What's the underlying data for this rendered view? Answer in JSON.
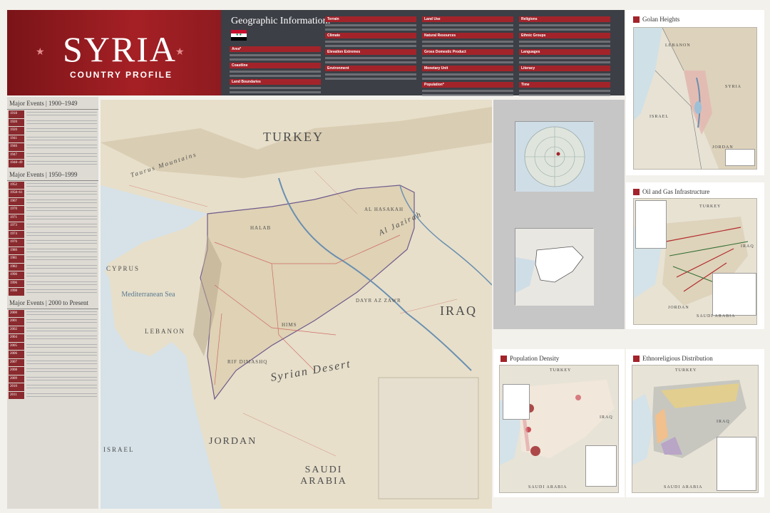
{
  "header": {
    "title": "SYRIA",
    "subtitle": "COUNTRY PROFILE",
    "geo_heading": "Geographic Information:",
    "geo_sections": [
      "Area*",
      "Coastline",
      "Land Boundaries",
      "Terrain",
      "Climate",
      "Elevation Extremes",
      "Environment",
      "Land Use",
      "Natural Resources",
      "Gross Domestic Product",
      "Monetary Unit",
      "Population*",
      "Religions",
      "Ethnic Groups",
      "Languages",
      "Literacy",
      "Time"
    ]
  },
  "events": {
    "sections": [
      {
        "heading": "Major Events | 1900–1949",
        "years": [
          "1918",
          "1920",
          "1920",
          "1941",
          "1946",
          "1947",
          "1948–49"
        ]
      },
      {
        "heading": "Major Events | 1950–1999",
        "years": [
          "1952",
          "1958–61",
          "1967",
          "1970",
          "1971",
          "1973",
          "1974",
          "1976",
          "1980",
          "1981",
          "1982",
          "1990",
          "1996",
          "1998"
        ]
      },
      {
        "heading": "Major Events | 2000 to Present",
        "years": [
          "2000",
          "2001",
          "2002",
          "2004",
          "2005",
          "2006",
          "2007",
          "2008",
          "2009",
          "2010",
          "2011"
        ]
      }
    ]
  },
  "map": {
    "labels": {
      "turkey": "TURKEY",
      "iraq": "IRAQ",
      "cyprus": "CYPRUS",
      "sea": "Mediterranean Sea",
      "lebanon": "LEBANON",
      "israel": "ISRAEL",
      "jordan": "JORDAN",
      "saudi": "SAUDI ARABIA",
      "desert": "Syrian Desert",
      "jazirah": "Al Jazirah",
      "taurus": "Taurus Mountains",
      "homs": "HIMS",
      "halab": "HALAB",
      "rif": "RIF DIMASHQ",
      "dayr": "DAYR AZ ZAWR",
      "hasakah": "AL HASAKAH"
    }
  },
  "panels": {
    "golan": {
      "title": "Golan Heights",
      "labels": [
        "LEBANON",
        "SYRIA",
        "ISRAEL",
        "JORDAN"
      ]
    },
    "oil": {
      "title": "Oil and Gas Infrastructure",
      "labels": [
        "TURKEY",
        "IRAQ",
        "JORDAN",
        "SAUDI ARABIA"
      ]
    },
    "population": {
      "title": "Population Density",
      "labels": [
        "TURKEY",
        "IRAQ",
        "SAUDI ARABIA"
      ]
    },
    "ethno": {
      "title": "Ethnoreligious Distribution",
      "labels": [
        "TURKEY",
        "IRAQ",
        "SAUDI ARABIA"
      ]
    }
  },
  "colors": {
    "accent": "#a3232a",
    "header_dark": "#3c3f45",
    "water": "#d6e2e8",
    "land": "#e6dfcc",
    "syria": "#dfd2b5"
  }
}
